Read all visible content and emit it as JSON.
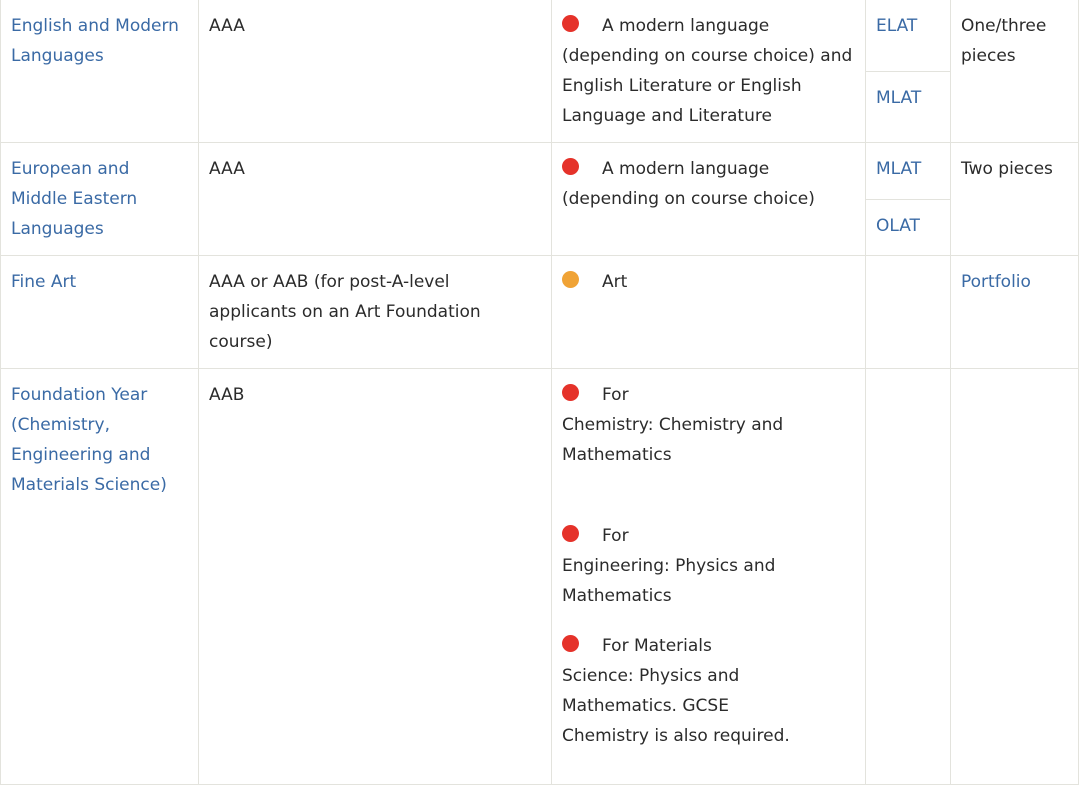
{
  "colors": {
    "link": "#3a6aa5",
    "essential": "#e5322a",
    "recommended": "#f0a336"
  },
  "rows": [
    {
      "course": "English and Modern Languages",
      "grades": "AAA",
      "subjects": [
        {
          "level": "essential",
          "icon": "red-dot",
          "text": "A modern language (depending on course choice) and English Literature or English Language and Literature"
        }
      ],
      "tests": [
        "ELAT",
        "MLAT"
      ],
      "written_work": "One/three pieces"
    },
    {
      "course": "European and Middle Eastern Languages",
      "grades": "AAA",
      "subjects": [
        {
          "level": "essential",
          "icon": "red-dot",
          "text": "A modern language (depending on course choice)"
        }
      ],
      "tests": [
        "MLAT",
        "OLAT"
      ],
      "written_work": "Two pieces"
    },
    {
      "course": "Fine Art",
      "grades": "AAA or AAB (for post-A-level applicants on an Art Foundation course)",
      "subjects": [
        {
          "level": "recommended",
          "icon": "orange-dot",
          "text": "Art"
        }
      ],
      "tests": [],
      "written_work": "Portfolio"
    },
    {
      "course": "Foundation Year (Chemistry, Engineering and Materials Science)",
      "grades": "AAB",
      "subjects": [
        {
          "level": "essential",
          "icon": "red-dot",
          "lead": "For",
          "text": "Chemistry: Chemistry and Mathematics"
        },
        {
          "level": "essential",
          "icon": "red-dot",
          "lead": "For",
          "text": "Engineering: Physics and Mathematics"
        },
        {
          "level": "essential",
          "icon": "red-dot",
          "lead": "For Materials",
          "text": "Science: Physics and Mathematics. GCSE Chemistry is also required."
        }
      ],
      "tests": [],
      "written_work": ""
    }
  ]
}
